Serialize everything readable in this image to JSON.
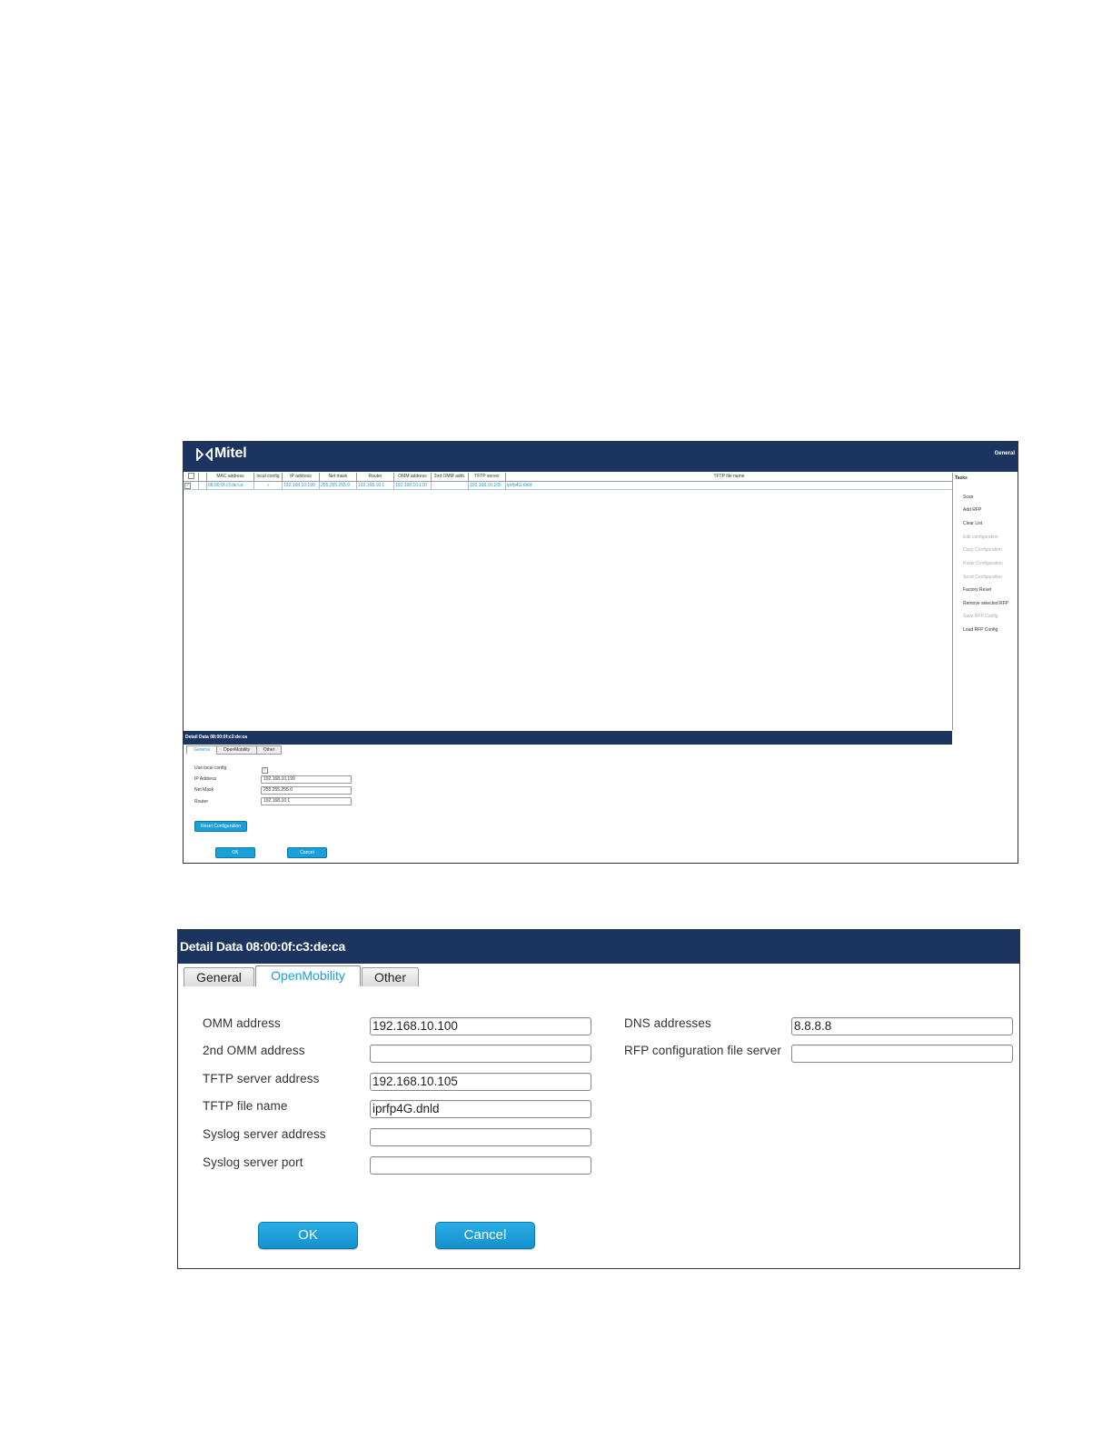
{
  "screen1": {
    "brand": "Mitel",
    "header_right": "General",
    "columns": [
      "MAC address",
      "local config",
      "IP address",
      "Net mask",
      "Router",
      "OMM address",
      "2nd OMM addr.",
      "TFTP server",
      "TFTP file name"
    ],
    "row": {
      "mac": "08:00:0f:c3:de:ca",
      "local_config": "✓",
      "ip": "192.168.10.199",
      "netmask": "255.255.255.0",
      "router": "192.168.10.1",
      "omm": "192.168.10.120",
      "omm2": "-",
      "tftp_server": "192.168.10.105",
      "tftp_file": "iprfp4G.dnld"
    },
    "tasks_title": "Tasks",
    "tasks": [
      {
        "label": "Scan",
        "enabled": true
      },
      {
        "label": "Add RFP",
        "enabled": true
      },
      {
        "label": "Clear List",
        "enabled": true
      },
      {
        "label": "Edit configuration",
        "enabled": false
      },
      {
        "label": "Copy Configuration",
        "enabled": false
      },
      {
        "label": "Paste Configuration",
        "enabled": false
      },
      {
        "label": "Send Configuration",
        "enabled": false
      },
      {
        "label": "Factory Reset",
        "enabled": true
      },
      {
        "label": "Remove selected RFP",
        "enabled": true
      },
      {
        "label": "Save RFP Config",
        "enabled": false
      },
      {
        "label": "Load RFP Config",
        "enabled": true
      }
    ],
    "detail_title": "Detail Data 08:00:0f:c3:de:ca",
    "tabs": [
      "General",
      "OpenMobility",
      "Other"
    ],
    "form": {
      "use_local_label": "Use local config",
      "use_local_checked": "✓",
      "ip_label": "IP Address",
      "ip_value": "192.168.10.199",
      "netmask_label": "Net Mask",
      "netmask_value": "255.255.255.0",
      "router_label": "Router",
      "router_value": "192.168.10.1"
    },
    "reset_button": "Reset Configuration",
    "ok_button": "OK",
    "cancel_button": "Cancel"
  },
  "screen2": {
    "title": "Detail Data 08:00:0f:c3:de:ca",
    "tabs": [
      "General",
      "OpenMobility",
      "Other"
    ],
    "active_tab": "OpenMobility",
    "left_fields": [
      {
        "label": "OMM address",
        "value": "192.168.10.100"
      },
      {
        "label": "2nd OMM address",
        "value": ""
      },
      {
        "label": "TFTP server address",
        "value": "192.168.10.105"
      },
      {
        "label": "TFTP file name",
        "value": "iprfp4G.dnld"
      },
      {
        "label": "Syslog server address",
        "value": ""
      },
      {
        "label": "Syslog server port",
        "value": ""
      }
    ],
    "right_fields": [
      {
        "label": "DNS addresses",
        "value": "8.8.8.8"
      },
      {
        "label": "RFP configuration file server",
        "value": ""
      }
    ],
    "ok_button": "OK",
    "cancel_button": "Cancel"
  },
  "colors": {
    "header_bg": "#1c3560",
    "accent": "#1a9fd6"
  }
}
